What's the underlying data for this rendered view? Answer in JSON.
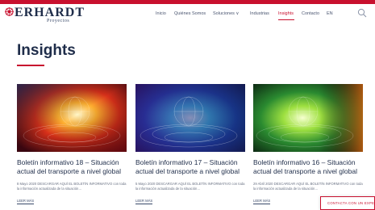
{
  "brand": {
    "name": "ERHARDT",
    "subtitle": "Proyectos"
  },
  "nav": {
    "items": [
      {
        "label": "Inicio"
      },
      {
        "label": "Quiénes Somos"
      },
      {
        "label": "Soluciones ∨"
      },
      {
        "label": "Industrias"
      },
      {
        "label": "Insights",
        "active": true
      },
      {
        "label": "Contacto"
      },
      {
        "label": "EN"
      }
    ]
  },
  "page": {
    "title": "Insights"
  },
  "cards": [
    {
      "title": "Boletín informativo 18 – Situación actual del transporte a nivel global",
      "meta": "8 Mayo 2020 DESCARGAR AQUÍ EL BOLETÍN INFORMATIVO con toda la información actualizada de la situación…",
      "more": "LEER MÁS",
      "image": "abstract-globe-warm-red"
    },
    {
      "title": "Boletín informativo 17 – Situación actual del transporte a nivel global",
      "meta": "5 Mayo 2020 DESCARGAR AQUÍ EL BOLETÍN INFORMATIVO con toda la información actualizada de la situación…",
      "more": "LEER MÁS",
      "image": "abstract-globe-blue"
    },
    {
      "title": "Boletín informativo 16 – Situación actual del transporte a nivel global",
      "meta": "29 Abril 2020 DESCARGAR AQUÍ EL BOLETÍN INFORMATIVO con toda la información actualizada de la situación…",
      "more": "LEER MÁS",
      "image": "abstract-globe-green-orange"
    }
  ],
  "contact_button": {
    "label": "CONTACTA CON UN EXPE"
  },
  "colors": {
    "accent": "#c8102e",
    "navy": "#1f2d4a"
  },
  "icons": {
    "search": "search-icon",
    "logo": "logo-mark-icon"
  }
}
